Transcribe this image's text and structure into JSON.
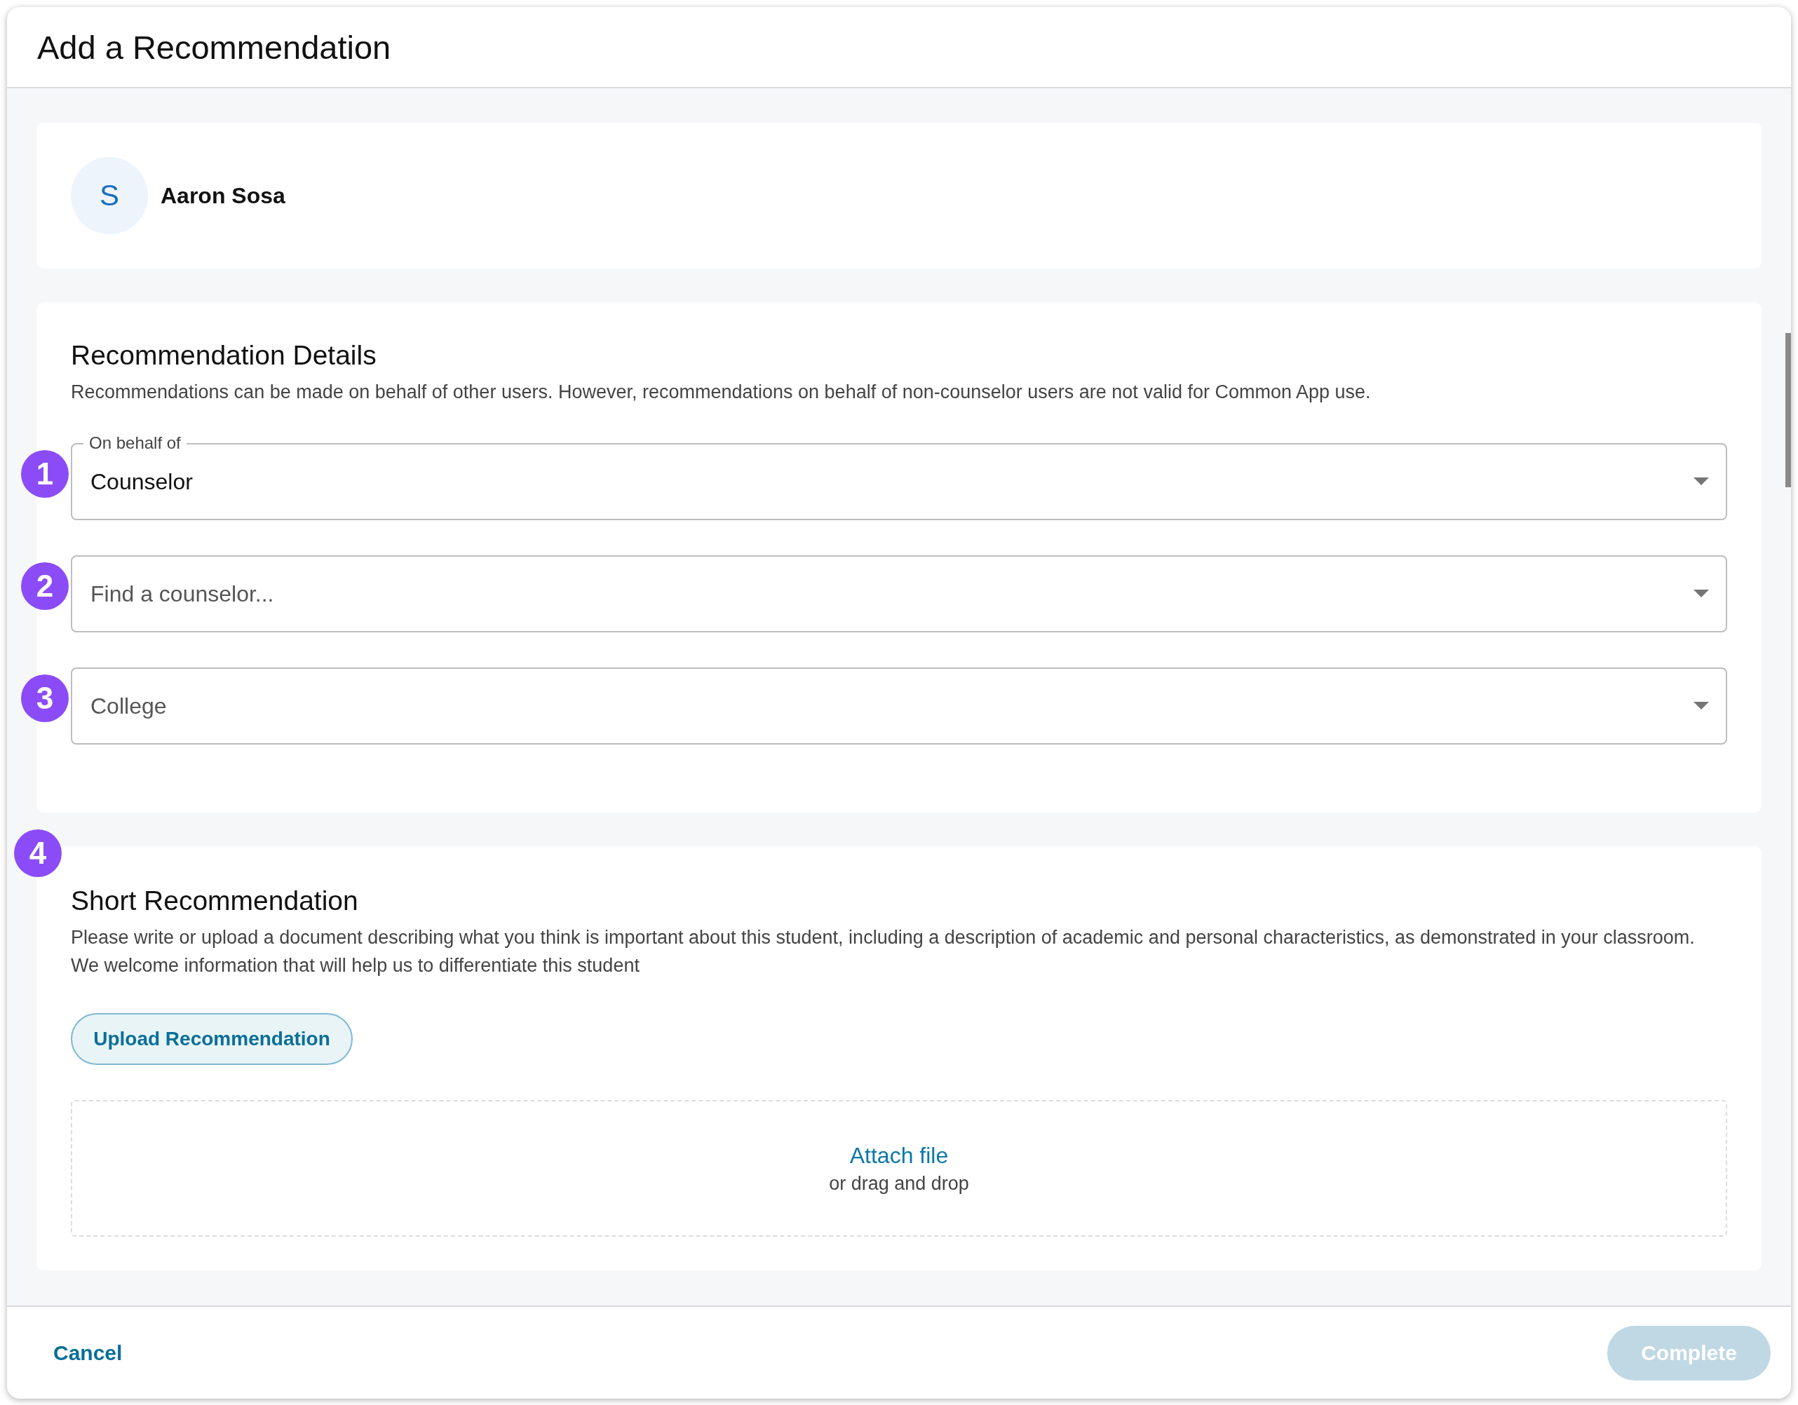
{
  "dialog": {
    "title": "Add a Recommendation"
  },
  "student": {
    "initial": "S",
    "name": "Aaron Sosa"
  },
  "details": {
    "heading": "Recommendation Details",
    "description": "Recommendations can be made on behalf of other users. However, recommendations on behalf of non-counselor users are not valid for Common App use.",
    "fields": [
      {
        "step": "1",
        "label": "On behalf of",
        "value": "Counselor"
      },
      {
        "step": "2",
        "placeholder": "Find a counselor..."
      },
      {
        "step": "3",
        "placeholder": "College"
      }
    ]
  },
  "short_recommendation": {
    "step": "4",
    "heading": "Short Recommendation",
    "description": "Please write or upload a document describing what you think is important about this student, including a description of academic and personal characteristics, as demonstrated in your classroom. We welcome information that will help us to differentiate this student",
    "upload_button": "Upload Recommendation",
    "dropzone": {
      "link": "Attach file",
      "hint": "or drag and drop"
    }
  },
  "footer": {
    "cancel": "Cancel",
    "complete": {
      "label": "Complete",
      "disabled": true
    }
  }
}
